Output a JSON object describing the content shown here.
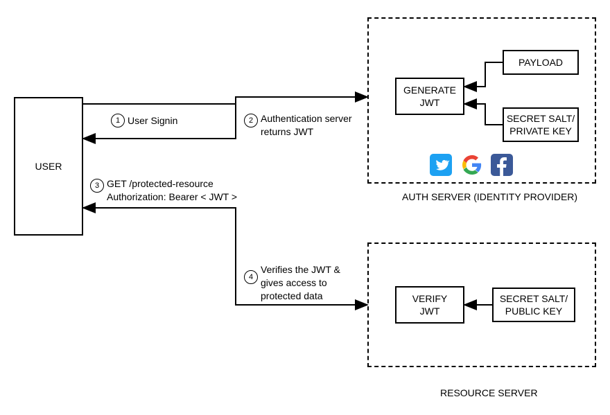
{
  "diagram": {
    "user_box": "USER",
    "generate_jwt": "GENERATE\nJWT",
    "payload": "PAYLOAD",
    "salt_private": "SECRET SALT/\nPRIVATE KEY",
    "verify_jwt": "VERIFY\nJWT",
    "salt_public": "SECRET SALT/\nPUBLIC KEY",
    "auth_server_caption": "AUTH SERVER (IDENTITY PROVIDER)",
    "resource_server_caption": "RESOURCE SERVER"
  },
  "steps": {
    "n1": "1",
    "n2": "2",
    "n3": "3",
    "n4": "4",
    "s1": "User Signin",
    "s2": "Authentication server\nreturns JWT",
    "s3": "GET /protected-resource\nAuthorization: Bearer  < JWT >",
    "s4": "Verifies the JWT &\ngives access to\nprotected data"
  },
  "icons": {
    "twitter": "twitter-icon",
    "google": "google-icon",
    "facebook": "facebook-icon"
  },
  "colors": {
    "twitter": "#1DA1F2",
    "google_red": "#EA4335",
    "google_yellow": "#FBBC05",
    "google_green": "#34A853",
    "google_blue": "#4285F4",
    "facebook": "#3b5998"
  }
}
